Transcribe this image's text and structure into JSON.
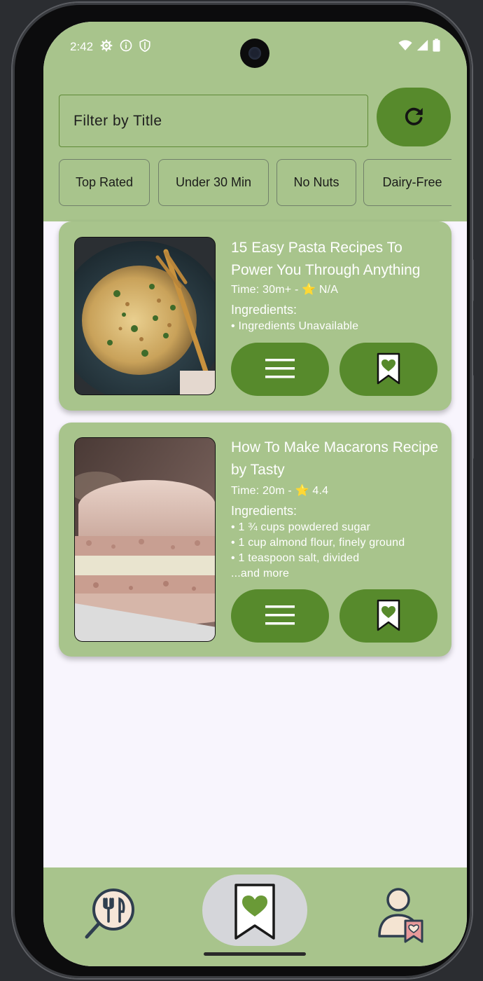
{
  "status_bar": {
    "time": "2:42"
  },
  "search": {
    "placeholder": "Filter by Title"
  },
  "filters": [
    "Top Rated",
    "Under 30 Min",
    "No Nuts",
    "Dairy-Free"
  ],
  "recipes": [
    {
      "title": "15 Easy Pasta Recipes To Power You Through Anything",
      "meta": "Time: 30m+ - ⭐ N/A",
      "ingredients_heading": "Ingredients:",
      "ingredients": [
        "• Ingredients Unavailable"
      ]
    },
    {
      "title": "How To Make Macarons Recipe by Tasty",
      "meta": "Time: 20m - ⭐ 4.4",
      "ingredients_heading": "Ingredients:",
      "ingredients": [
        "• 1 ¾ cups powdered sugar",
        "• 1 cup almond flour, finely ground",
        "• 1 teaspoon salt, divided",
        "...and more"
      ]
    }
  ],
  "icons": {
    "settings": "gear-icon",
    "info": "info-icon",
    "shield": "shield-icon",
    "wifi": "wifi-icon",
    "signal": "signal-icon",
    "battery": "battery-icon",
    "refresh": "refresh-icon",
    "menu": "menu-icon",
    "save": "bookmark-heart-icon",
    "nav_search": "search-recipes-icon",
    "nav_saved": "saved-recipes-icon",
    "nav_profile": "profile-icon"
  },
  "colors": {
    "primary": "#578a2c",
    "surface": "#a8c48c",
    "background": "#f8f5fd"
  }
}
